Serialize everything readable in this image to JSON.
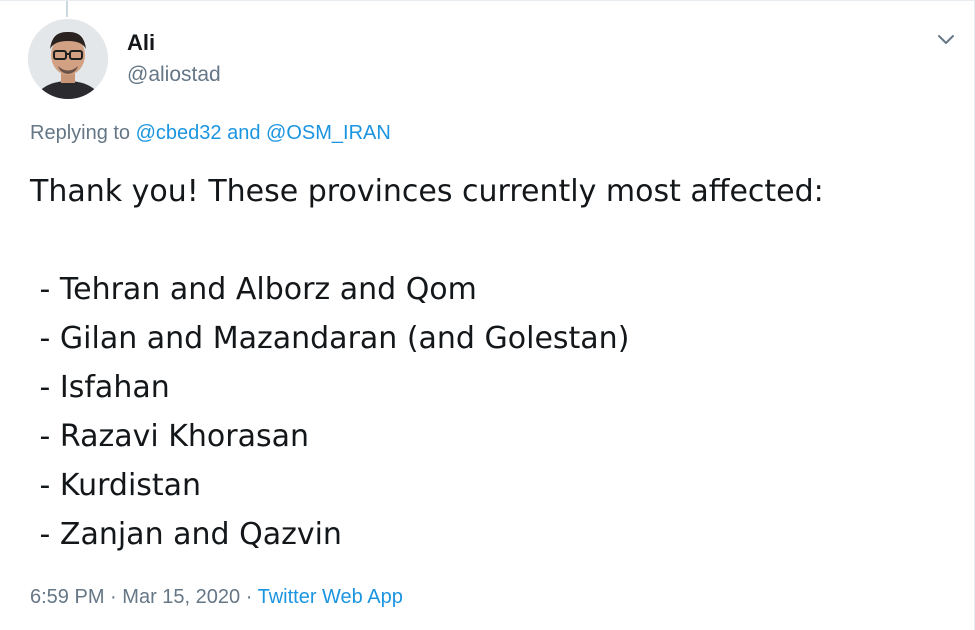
{
  "author": {
    "name": "Ali",
    "handle": "@aliostad"
  },
  "reply_context": {
    "prefix": "Replying to",
    "mention_1": "@cbed32",
    "conjunction": "and",
    "mention_2": "@OSM_IRAN"
  },
  "tweet": {
    "lines": [
      "Thank you! These provinces currently most affected:",
      "",
      " - Tehran and Alborz and Qom",
      " - Gilan and Mazandaran (and Golestan)",
      " - Isfahan",
      " - Razavi Khorasan",
      " - Kurdistan",
      " - Zanjan and Qazvin"
    ]
  },
  "meta": {
    "time": "6:59 PM",
    "separator": "·",
    "date": "Mar 15, 2020",
    "source": "Twitter Web App"
  },
  "icons": {
    "menu": "chevron-down-icon",
    "avatar": "avatar"
  },
  "colors": {
    "link": "#1b95e0",
    "secondary_text": "#657786",
    "primary_text": "#14171a"
  }
}
